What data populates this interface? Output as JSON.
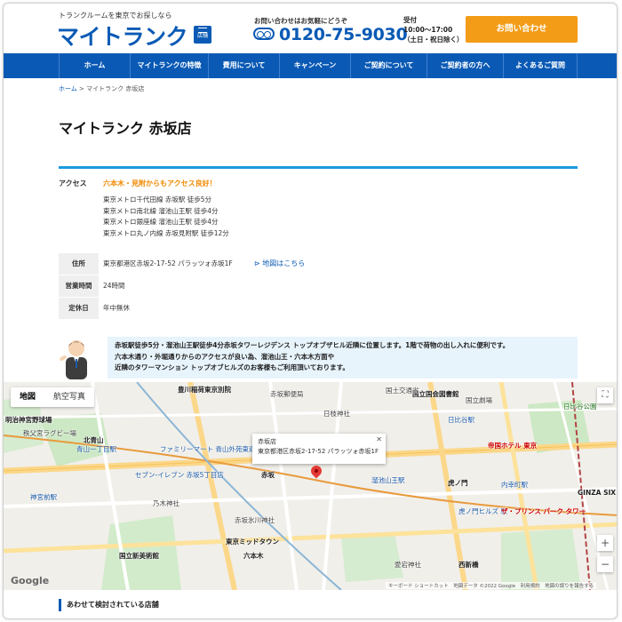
{
  "header": {
    "tagline": "トランクルームを東京でお探しなら",
    "logo": "マイトランク",
    "store_button": "店舗",
    "contact_label": "お問い合わせはお気軽にどうぞ",
    "phone": "0120-75-9030",
    "hours_label": "受付",
    "hours_time": "10:00〜17:00",
    "hours_note": "（土日・祝日除く）",
    "cta_label": "お問い合わせ"
  },
  "nav": {
    "items": [
      {
        "label": "ホーム"
      },
      {
        "label": "マイトランクの特徴"
      },
      {
        "label": "費用について"
      },
      {
        "label": "キャンペーン"
      },
      {
        "label": "ご契約について"
      },
      {
        "label": "ご契約者の方へ"
      },
      {
        "label": "よくあるご質問"
      }
    ]
  },
  "breadcrumb": {
    "home": "ホーム",
    "separator": ">",
    "current": "マイトランク 赤坂店"
  },
  "page_title": "マイトランク 赤坂店",
  "access": {
    "label": "アクセス",
    "highlight": "六本木・見附からもアクセス良好！",
    "lines": [
      "東京メトロ千代田線 赤坂駅 徒歩5分",
      "東京メトロ南北線 溜池山王駅 徒歩4分",
      "東京メトロ銀座線 溜池山王駅 徒歩4分",
      "東京メトロ丸ノ内線 赤坂見附駅 徒歩12分"
    ]
  },
  "info": {
    "address_label": "住所",
    "address_value": "東京都港区赤坂2-17-52 パラッツォ赤坂1F",
    "map_link": "地図はこちら",
    "hours_label": "営業時間",
    "hours_value": "24時間",
    "closed_label": "定休日",
    "closed_value": "年中無休"
  },
  "comment": {
    "lines": [
      "赤坂駅徒歩5分・溜池山王駅徒歩4分赤坂タワーレジデンス トップオブザヒル近隣に位置します。1階で荷物の出し入れに便利です。",
      "六本木通り・外堀通りからのアクセスが良い為、溜池山王・六本木方面や",
      "近隣のタワーマンション トップオブヒルズのお客様もご利用頂いております。"
    ]
  },
  "map": {
    "tabs": [
      "地図",
      "航空写真"
    ],
    "info_window": {
      "title": "赤坂店",
      "address": "東京都港区赤坂2-17-52 パラッツォ赤坂1F"
    },
    "places": [
      {
        "name": "豊川稲荷東京別院",
        "cls": "bold"
      },
      {
        "name": "赤坂郵便局",
        "cls": ""
      },
      {
        "name": "国立国会図書館",
        "cls": "bold"
      },
      {
        "name": "国立劇場",
        "cls": ""
      },
      {
        "name": "日比谷公園",
        "cls": "green"
      },
      {
        "name": "日比谷駅",
        "cls": "blue"
      },
      {
        "name": "帝国ホテル 東京",
        "cls": "red"
      },
      {
        "name": "明治神宮野球場",
        "cls": "bold"
      },
      {
        "name": "秩父宮ラグビー場",
        "cls": ""
      },
      {
        "name": "北青山",
        "cls": "bold"
      },
      {
        "name": "青山一丁目駅",
        "cls": "blue"
      },
      {
        "name": "ファミリーマート 青山外苑東通り店",
        "cls": "blue"
      },
      {
        "name": "セブン-イレブン 赤坂5丁目店",
        "cls": "blue"
      },
      {
        "name": "神宮前駅",
        "cls": "blue"
      },
      {
        "name": "乃木神社",
        "cls": ""
      },
      {
        "name": "赤坂氷川神社",
        "cls": ""
      },
      {
        "name": "東京ミッドタウン",
        "cls": "bold"
      },
      {
        "name": "国立新美術館",
        "cls": "bold"
      },
      {
        "name": "六本木",
        "cls": "bold"
      },
      {
        "name": "溜池山王駅",
        "cls": "blue"
      },
      {
        "name": "虎ノ門",
        "cls": "bold"
      },
      {
        "name": "愛宕神社",
        "cls": ""
      },
      {
        "name": "西新橋",
        "cls": "bold"
      },
      {
        "name": "内幸町駅",
        "cls": "blue"
      },
      {
        "name": "虎ノ門ヒルズ 駅",
        "cls": "blue"
      },
      {
        "name": "GINZA SIX",
        "cls": "bold"
      },
      {
        "name": "ザ・プリンス パーク タワー",
        "cls": "red"
      },
      {
        "name": "日枝神社",
        "cls": ""
      },
      {
        "name": "赤坂",
        "cls": "bold"
      },
      {
        "name": "国土交通省",
        "cls": ""
      }
    ],
    "footer": "キーボード ショートカット　地図データ ©2022 Google　利用規約　地図の誤りを報告する",
    "google": "Google",
    "zoom_in": "+",
    "zoom_out": "−"
  },
  "related_heading": "あわせて検討されている店舗",
  "colors": {
    "brand": "#0a5ab5",
    "cta": "#f39c18",
    "accent_rule": "#1a9ae0",
    "highlight": "#f08a00"
  }
}
